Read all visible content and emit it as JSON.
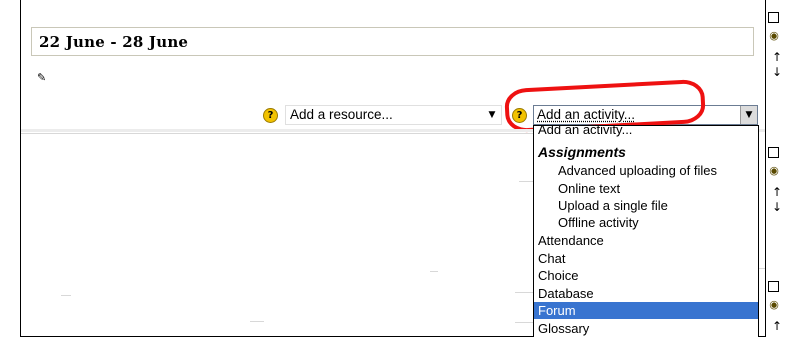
{
  "section": {
    "title": "22 June - 28 June"
  },
  "resource_select": {
    "value": "Add a resource...",
    "help": "?"
  },
  "activity_select": {
    "value": "Add an activity...",
    "help": "?"
  },
  "activity_dropdown": {
    "options": [
      {
        "label": "Add an activity...",
        "kind": "option"
      },
      {
        "label": "Assignments",
        "kind": "group"
      },
      {
        "label": "Advanced uploading of files",
        "kind": "sub"
      },
      {
        "label": "Online text",
        "kind": "sub"
      },
      {
        "label": "Upload a single file",
        "kind": "sub"
      },
      {
        "label": "Offline activity",
        "kind": "sub"
      },
      {
        "label": "Attendance",
        "kind": "option"
      },
      {
        "label": "Chat",
        "kind": "option"
      },
      {
        "label": "Choice",
        "kind": "option"
      },
      {
        "label": "Database",
        "kind": "option"
      },
      {
        "label": "Forum",
        "kind": "option",
        "selected": true
      },
      {
        "label": "Glossary",
        "kind": "option"
      }
    ]
  },
  "colors": {
    "highlight": "#3874d0",
    "annotation_ring": "#ee1111",
    "help_icon": "#f2c200"
  }
}
